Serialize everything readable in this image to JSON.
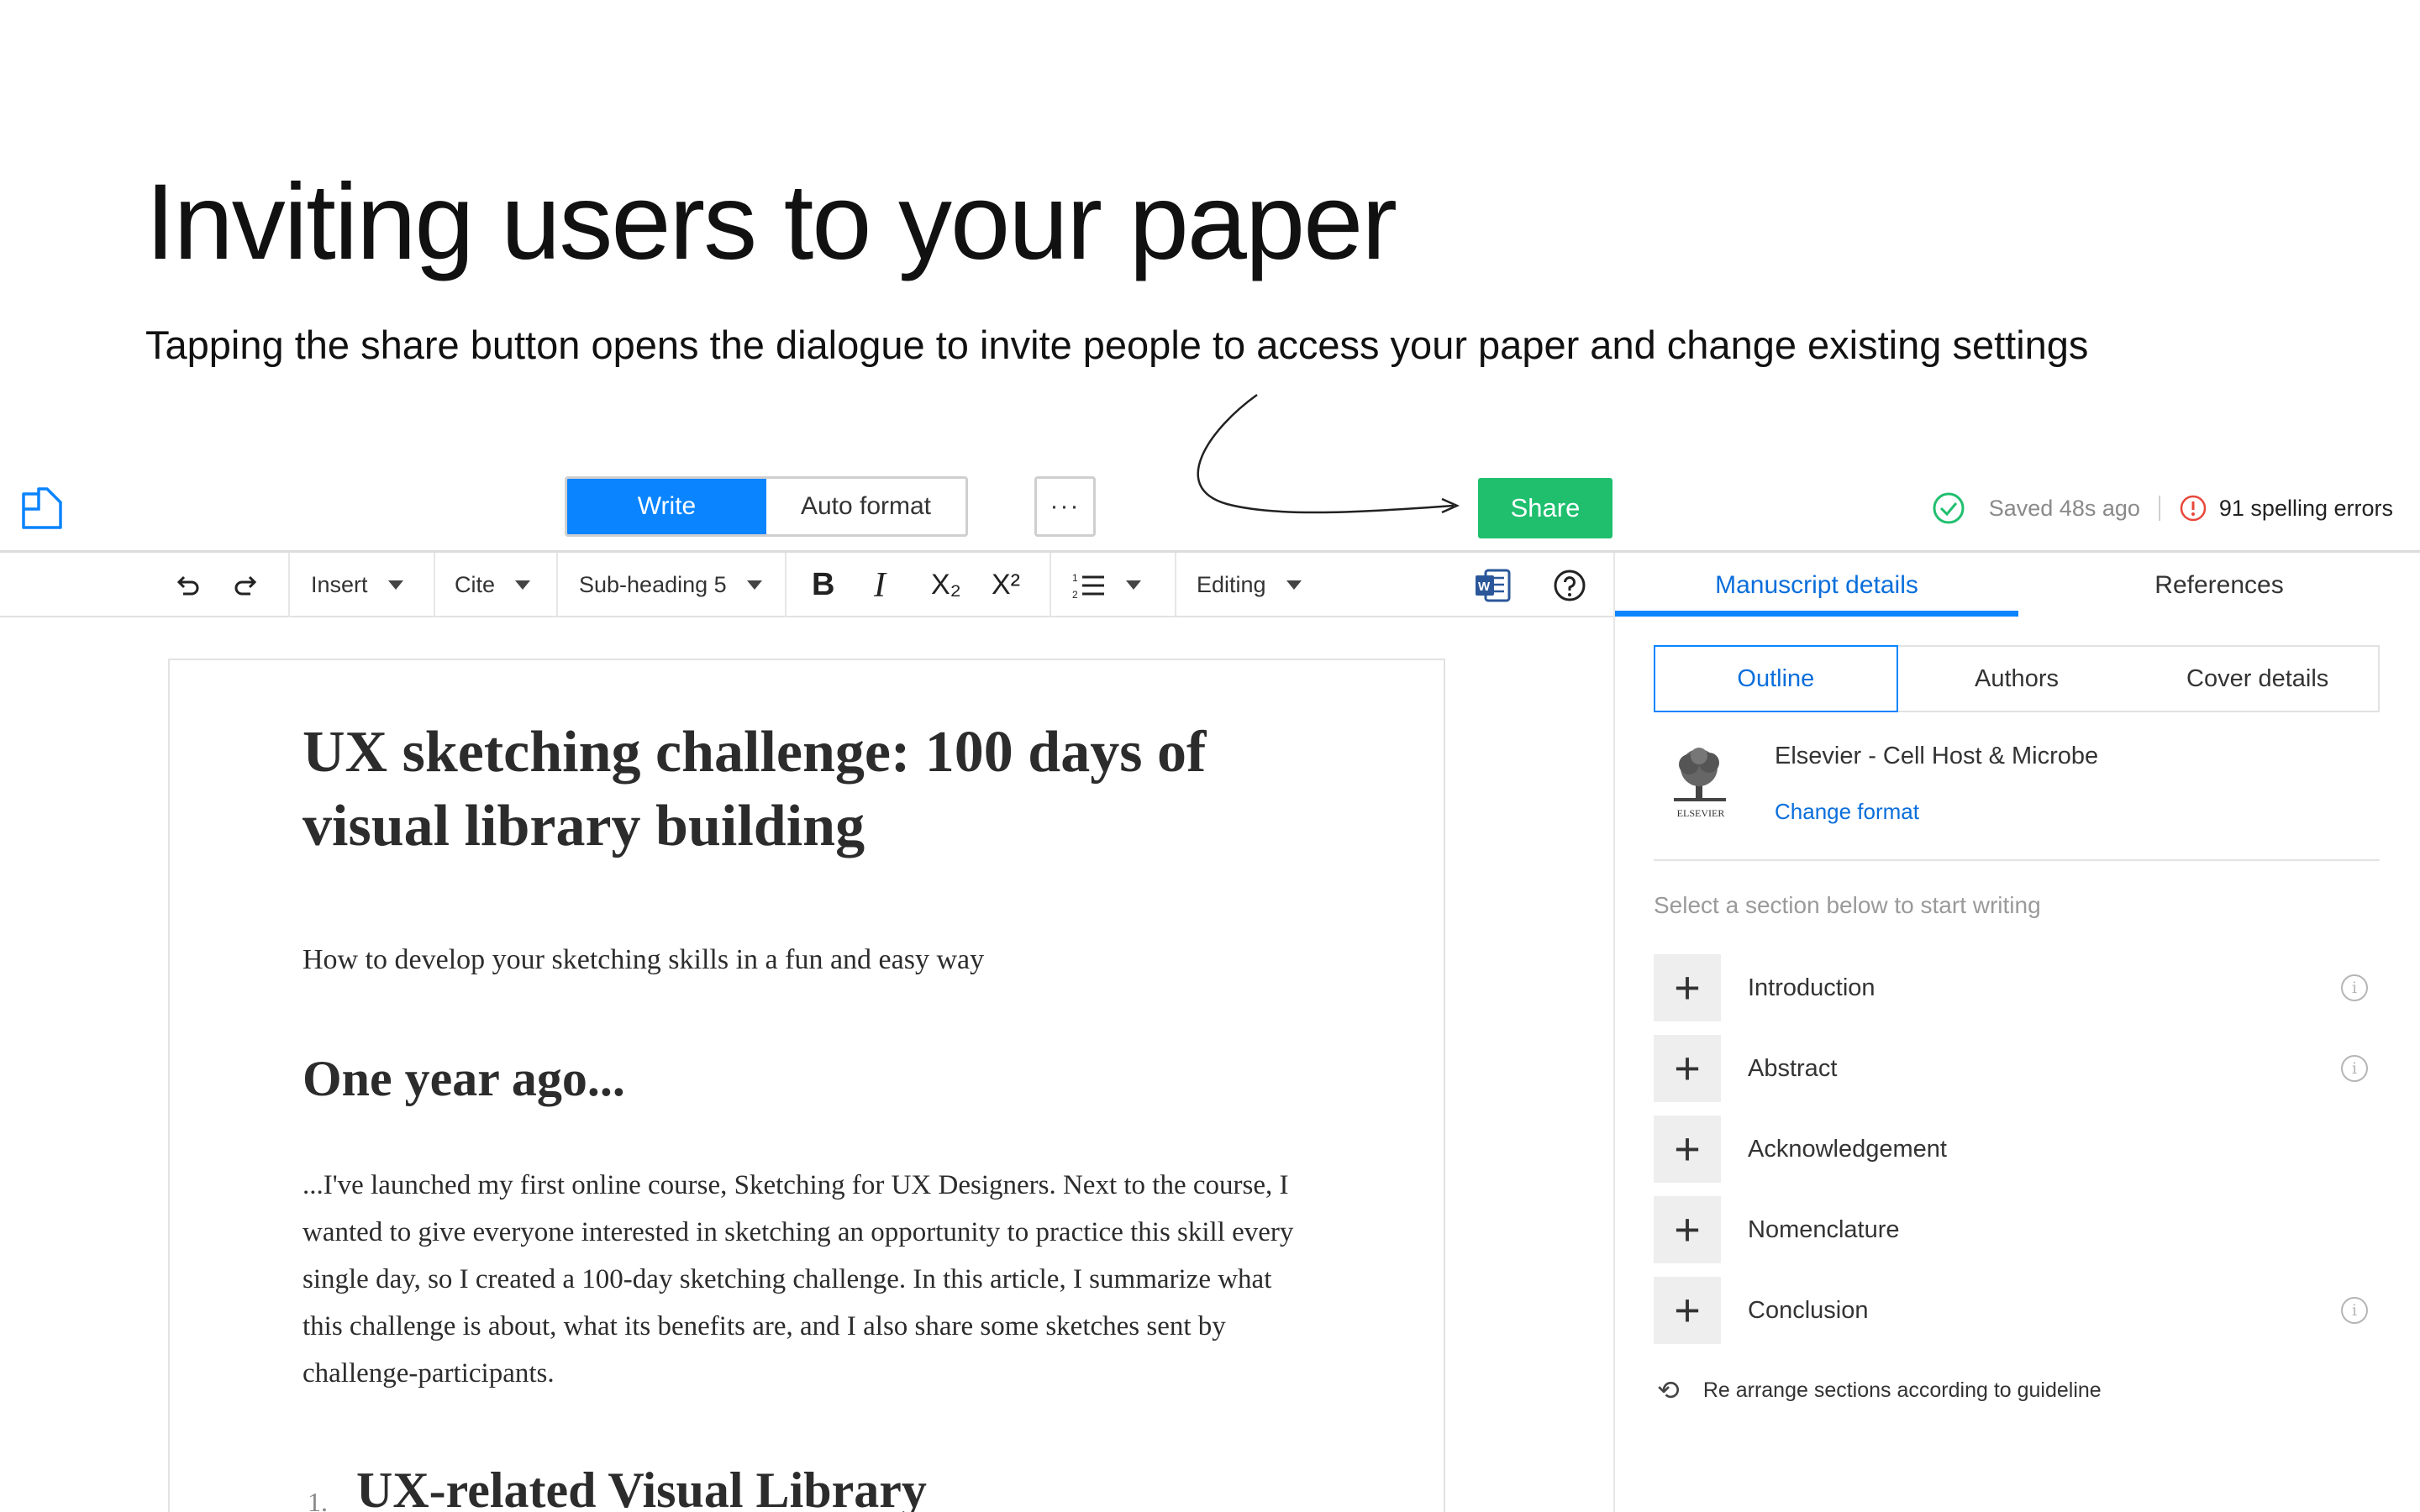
{
  "slide": {
    "title": "Inviting users to your paper",
    "subtitle": "Tapping the share button opens the dialogue to invite people to access your paper and change existing settings"
  },
  "topbar": {
    "modes": [
      "Write",
      "Auto format"
    ],
    "active_mode": "Write",
    "more_label": "···",
    "share_label": "Share",
    "saved_text": "Saved 48s ago",
    "spelling_errors": "91 spelling errors"
  },
  "toolbar": {
    "insert": "Insert",
    "cite": "Cite",
    "heading": "Sub-heading 5",
    "bold": "B",
    "italic": "I",
    "subscript": "X₂",
    "superscript": "X²",
    "editing": "Editing"
  },
  "panel": {
    "tabs": [
      "Manuscript details",
      "References"
    ],
    "sub_tabs": [
      "Outline",
      "Authors",
      "Cover details"
    ],
    "journal": "Elsevier - Cell Host & Microbe",
    "publisher_logo_text": "ELSEVIER",
    "change_format": "Change format",
    "hint": "Select a section below to start writing",
    "sections": [
      {
        "label": "Introduction",
        "info": true
      },
      {
        "label": "Abstract",
        "info": true
      },
      {
        "label": "Acknowledgement",
        "info": false
      },
      {
        "label": "Nomenclature",
        "info": false
      },
      {
        "label": "Conclusion",
        "info": true
      }
    ],
    "rearrange": "Re arrange sections according to guideline"
  },
  "document": {
    "title": "UX sketching challenge: 100 days of visual library building",
    "subtitle": "How to develop your sketching skills in a fun and easy way",
    "heading": "One year ago...",
    "body": "...I've launched my first online course, Sketching for UX Designers. Next to the course, I wanted to give everyone interested in sketching an opportunity to practice this skill every single day, so I created a 100-day sketching challenge. In this article, I summarize what this challenge is about, what its benefits are, and I also share some sketches sent by challenge-participants.",
    "list_number": "1.",
    "list_heading": "UX-related Visual Library"
  },
  "colors": {
    "accent_blue": "#0a84ff",
    "share_green": "#1fbf6e",
    "error_red": "#e8473b",
    "ok_green": "#1fbf6e"
  }
}
